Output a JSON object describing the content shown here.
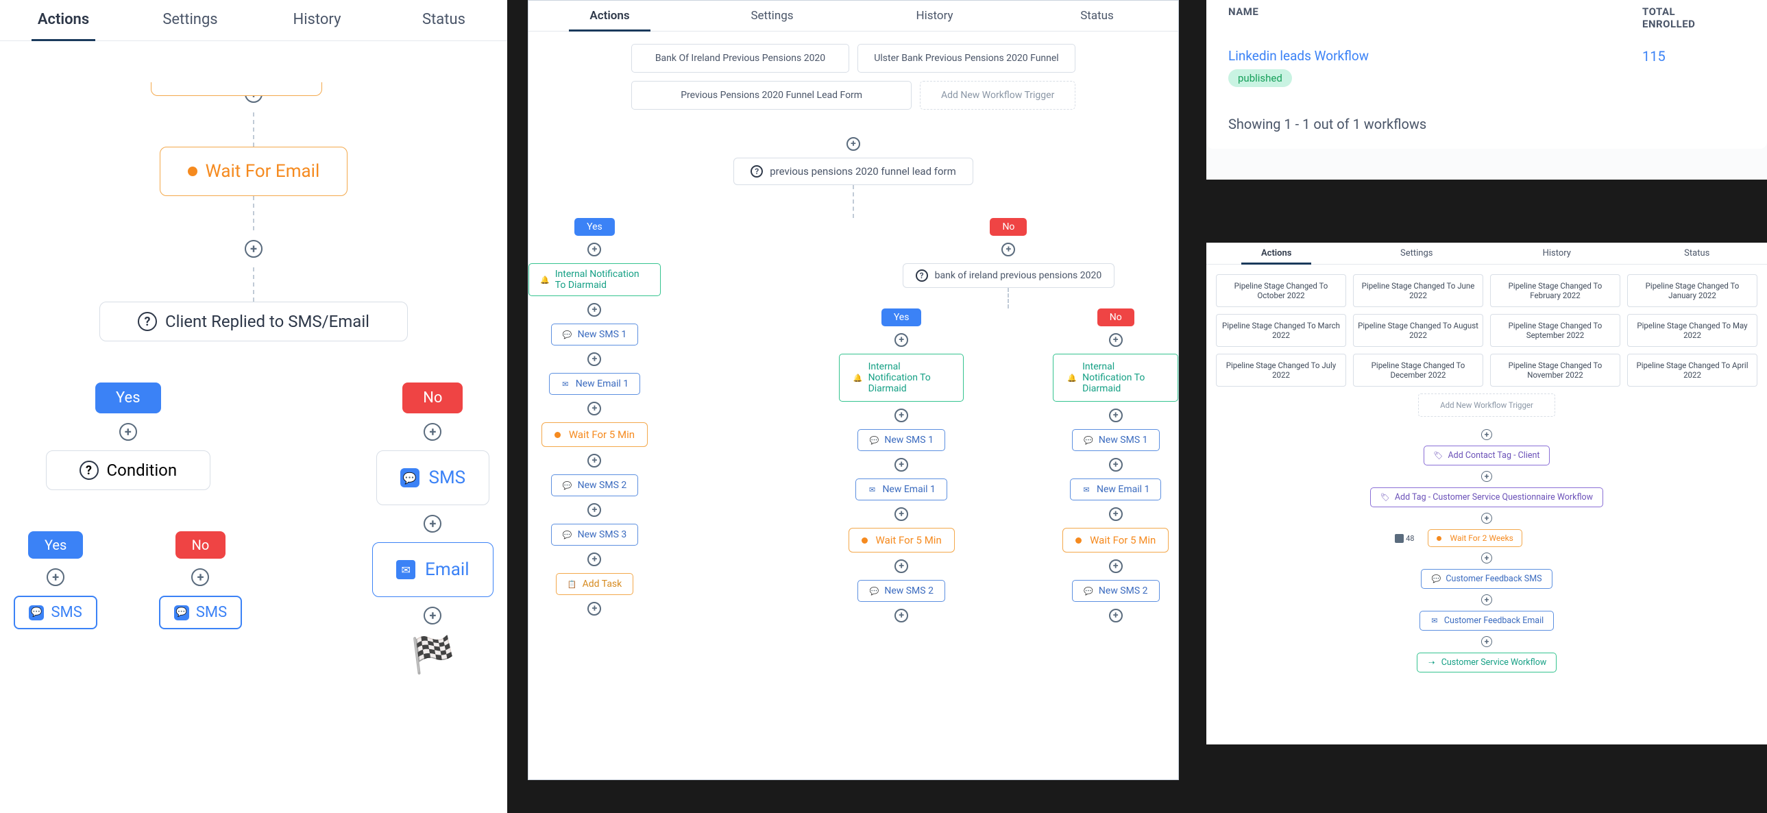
{
  "tabs": {
    "actions": "Actions",
    "settings": "Settings",
    "history": "History",
    "status": "Status"
  },
  "p1": {
    "wait_email": "Wait For Email",
    "condition_main": "Client Replied to SMS/Email",
    "yes": "Yes",
    "no": "No",
    "condition": "Condition",
    "sms": "SMS",
    "email": "Email"
  },
  "p2": {
    "triggers": {
      "t1": "Bank Of Ireland Previous Pensions 2020",
      "t2": "Ulster Bank Previous Pensions 2020 Funnel",
      "t3": "Previous Pensions 2020 Funnel Lead Form",
      "add": "Add New Workflow Trigger"
    },
    "start": "previous pensions 2020 funnel lead form",
    "yes": "Yes",
    "no": "No",
    "intern": "Internal Notification To Diarmaid",
    "boi_cond": "bank of ireland previous pensions 2020",
    "sms1": "New SMS 1",
    "sms2": "New SMS 2",
    "sms3": "New SMS 3",
    "email1": "New Email 1",
    "wait5": "Wait For 5 Min",
    "addtask": "Add Task"
  },
  "p3": {
    "col_name": "NAME",
    "col_total1": "TOTAL",
    "col_total2": "ENROLLED",
    "wf_name": "Linkedin leads Workflow",
    "wf_status": "published",
    "wf_count": "115",
    "foot": "Showing 1 - 1 out of 1 workflows"
  },
  "p4": {
    "t": {
      "oct": "Pipeline Stage Changed To October 2022",
      "jun": "Pipeline Stage Changed To June 2022",
      "feb": "Pipeline Stage Changed To February 2022",
      "jan": "Pipeline Stage Changed To January 2022",
      "mar": "Pipeline Stage Changed To March 2022",
      "aug": "Pipeline Stage Changed To August 2022",
      "sep": "Pipeline Stage Changed To September 2022",
      "may": "Pipeline Stage Changed To May 2022",
      "jul": "Pipeline Stage Changed To July 2022",
      "dec": "Pipeline Stage Changed To December 2022",
      "nov": "Pipeline Stage Changed To November 2022",
      "apr": "Pipeline Stage Changed To April 2022",
      "add": "Add New Workflow Trigger"
    },
    "tag_client": "Add Contact Tag - Client",
    "tag_cs": "Add Tag - Customer Service Questionnaire Workflow",
    "wait2w": "Wait For 2 Weeks",
    "user_count": "48",
    "fb_sms": "Customer Feedback SMS",
    "fb_email": "Customer Feedback Email",
    "cs_wf": "Customer Service Workflow"
  }
}
